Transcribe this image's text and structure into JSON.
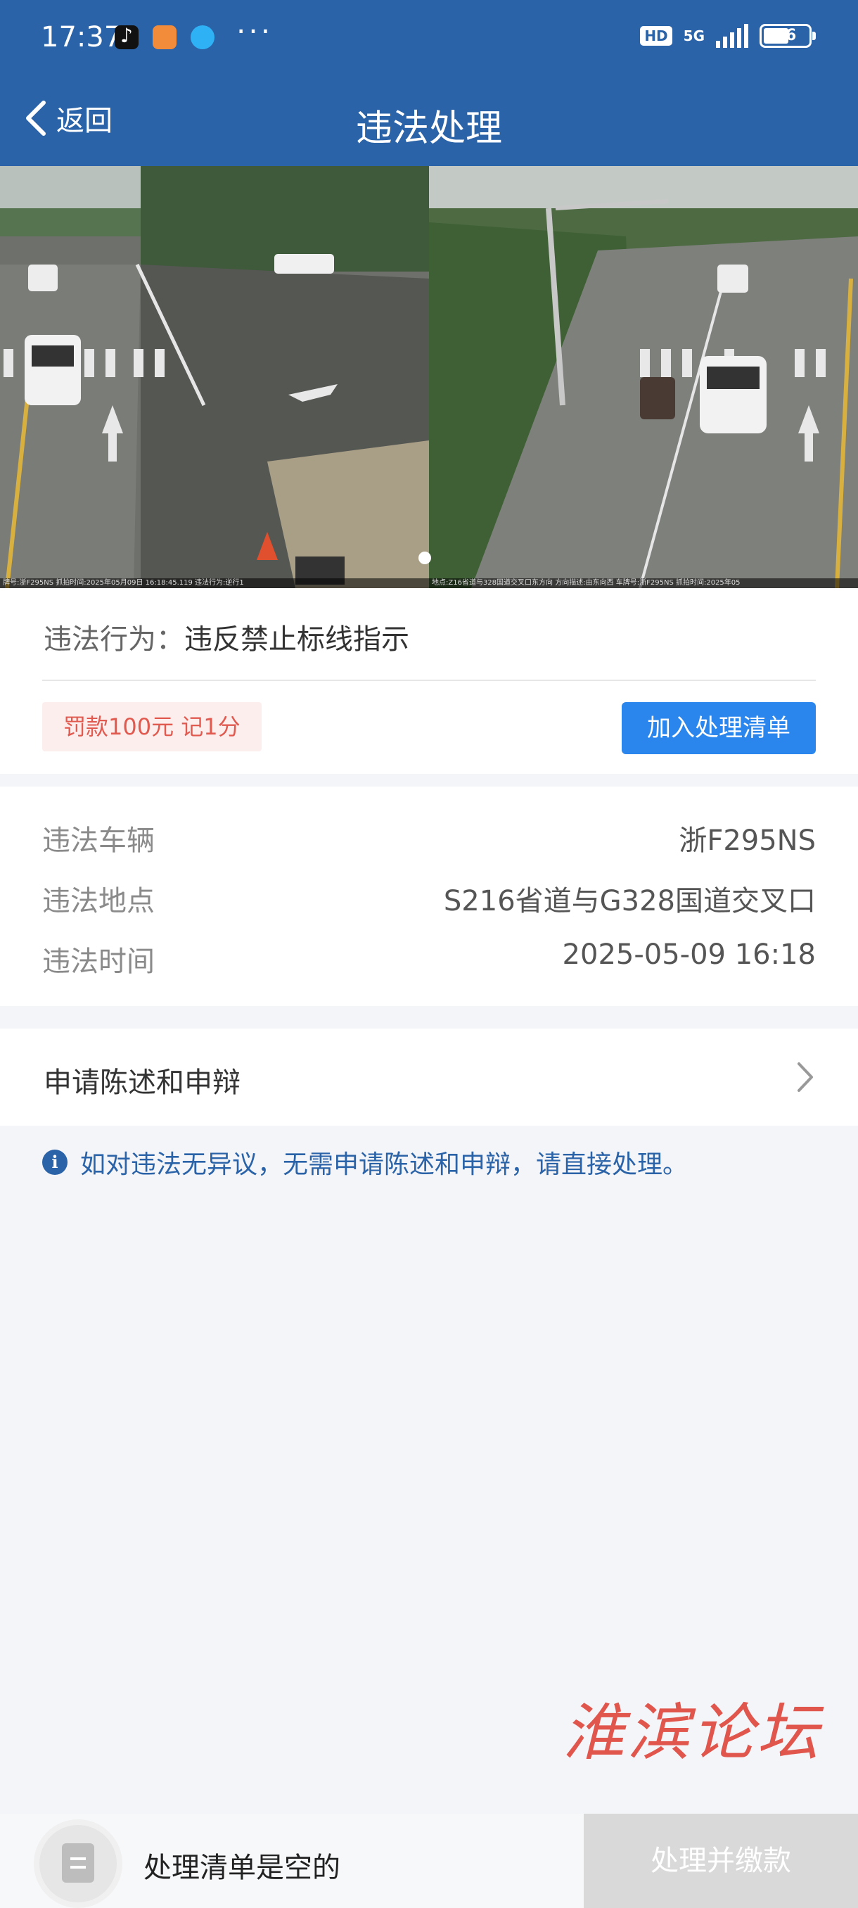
{
  "status_bar": {
    "time": "17:37",
    "more": "···",
    "hd": "HD",
    "network": "5G",
    "battery": "56",
    "battery_level": 0.56
  },
  "nav": {
    "back_label": "返回",
    "title": "违法处理"
  },
  "photos": {
    "left_caption": "牌号:浙F295NS 抓拍时间:2025年05月09日 16:18:45.119 违法行为:逆行1",
    "right_caption": "地点:Z16省道与328国道交叉口东方向 方向描述:由东向西 车牌号:浙F295NS 抓拍时间:2025年05",
    "count": 2,
    "active_index": 0
  },
  "violation": {
    "behavior_key": "违法行为：",
    "behavior_value": "违反禁止标线指示",
    "fine": "罚款100元 记1分",
    "add_button": "加入处理清单"
  },
  "details": {
    "vehicle_key": "违法车辆",
    "vehicle_value": "浙F295NS",
    "location_key": "违法地点",
    "location_value": "S216省道与G328国道交叉口",
    "time_key": "违法时间",
    "time_value": "2025-05-09 16:18"
  },
  "appeal": {
    "label": "申请陈述和申辩"
  },
  "notice": {
    "text": "如对违法无异议，无需申请陈述和申辩，请直接处理。"
  },
  "watermark": "淮滨论坛",
  "bottom": {
    "empty_label": "处理清单是空的",
    "pay_button": "处理并缴款"
  },
  "colors": {
    "header": "#2b63a8",
    "primary_button": "#2a86ec",
    "fine_text": "#e05a4f",
    "fine_bg": "#fdeeee",
    "disabled_button": "#d9d9d9"
  }
}
